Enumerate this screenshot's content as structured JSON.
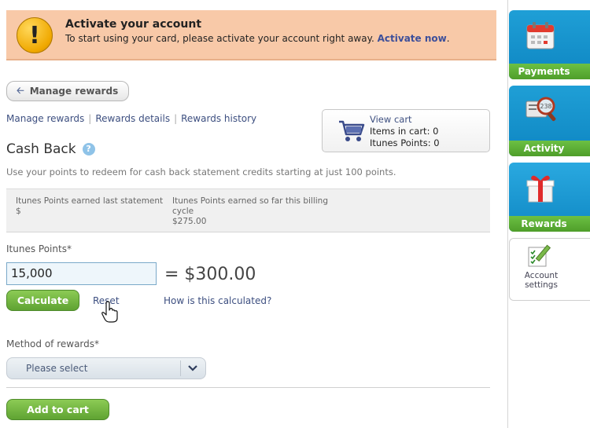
{
  "alert": {
    "icon": "warning-icon",
    "title": "Activate your account",
    "message": "To start using your card, please activate your account right away.",
    "link": "Activate now",
    "trailing": "."
  },
  "nav_back": {
    "label": "Manage rewards"
  },
  "breadcrumb": [
    "Manage rewards",
    "Rewards details",
    "Rewards history"
  ],
  "cart": {
    "title": "View cart",
    "items_line": "Items in cart: 0",
    "points_line": "Itunes Points: 0"
  },
  "section": {
    "title": "Cash Back",
    "description": "Use your points to redeem for cash back statement credits starting at just 100 points."
  },
  "stats": {
    "last_statement_label": "Itunes Points earned last statement",
    "last_statement_value": "$",
    "this_cycle_label": "Itunes Points earned so far this billing cycle",
    "this_cycle_value": "$275.00"
  },
  "points": {
    "label": "Itunes Points*",
    "value": "15,000",
    "result": "= $300.00"
  },
  "actions": {
    "calculate": "Calculate",
    "reset": "Reset",
    "how": "How is this calculated?"
  },
  "method": {
    "label": "Method of rewards*",
    "selected": "Please select"
  },
  "add_to_cart": "Add to cart",
  "sidebar": {
    "payments": "Payments",
    "activity": "Activity",
    "rewards": "Rewards",
    "account": "Account settings"
  },
  "colors": {
    "alert_bg": "#f8c9a8",
    "link": "#3d4f80",
    "green_button": "#5fa332",
    "nav_blue": "#0e86c2",
    "nav_green": "#4f9e2a"
  }
}
